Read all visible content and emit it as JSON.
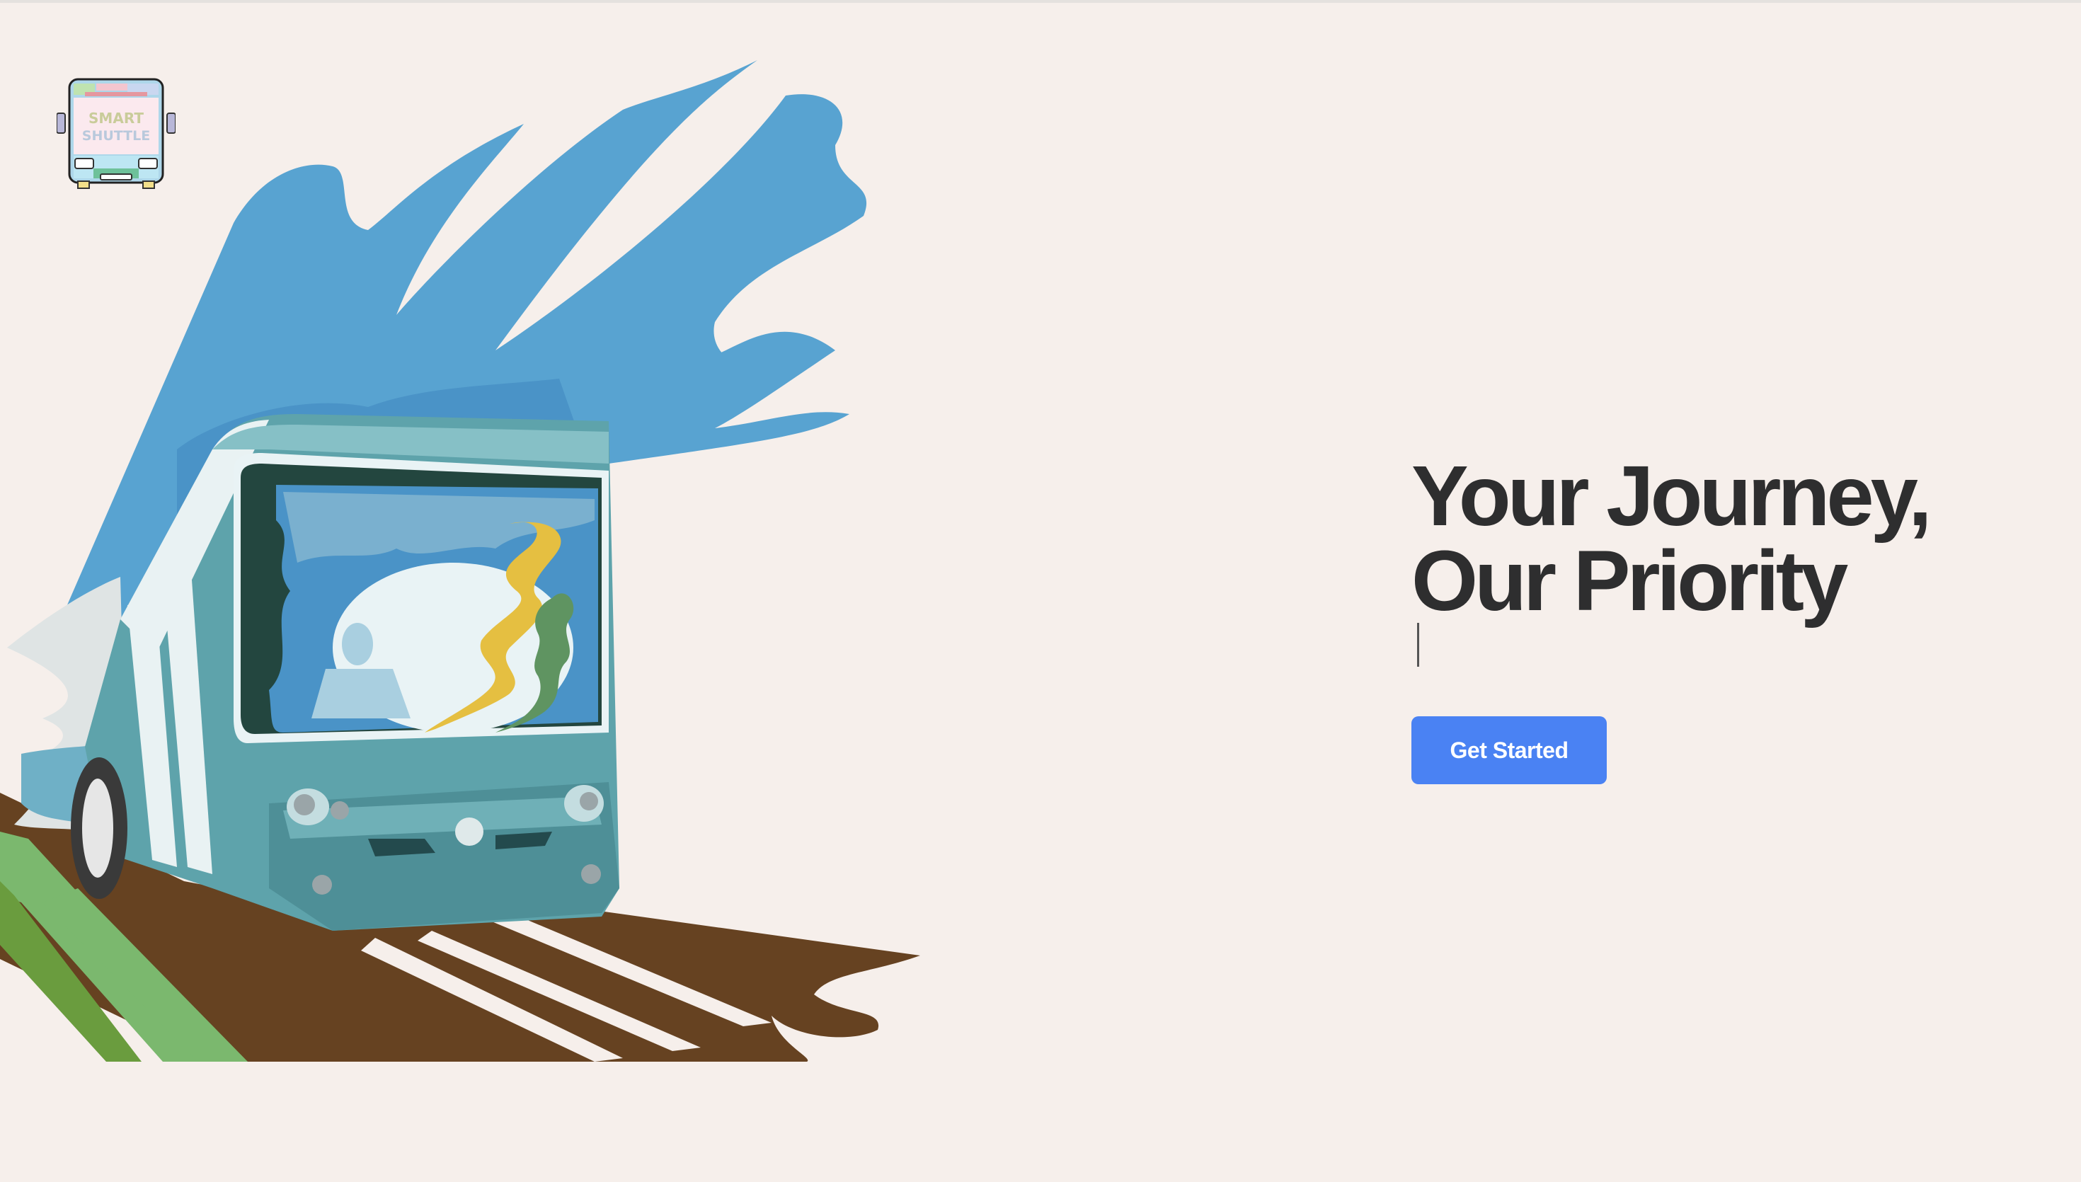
{
  "logo": {
    "line1": "SMART",
    "line2": "SHUTTLE"
  },
  "hero": {
    "headline_line1": "Your Journey,",
    "headline_line2": "Our Priority",
    "cta_label": "Get Started"
  },
  "colors": {
    "background": "#f6efeb",
    "accent": "#4a82f3",
    "headline": "#2e2e2f",
    "bus_body": "#5ea3ab",
    "sky_splash": "#58a3d1",
    "road": "#664221",
    "grass": "#7bb86e"
  },
  "icons": {
    "logo": "shuttle-bus-logo-icon",
    "hero": "bus-illustration"
  }
}
